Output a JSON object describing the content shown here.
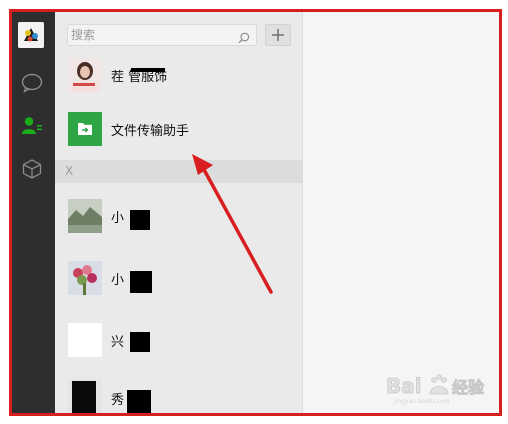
{
  "search": {
    "placeholder": "搜索"
  },
  "contacts": {
    "top_item": {
      "label": "茬 管服饰"
    },
    "file_transfer": {
      "label": "文件传输助手"
    },
    "section_header": "X",
    "items": [
      {
        "label": "小"
      },
      {
        "label": "小"
      },
      {
        "label": "兴"
      },
      {
        "label": "秀"
      }
    ]
  },
  "colors": {
    "annotation_red": "#d81e1e",
    "active_green": "#1aad19",
    "file_transfer_green": "#2ea646"
  },
  "icons": [
    "chat-icon",
    "contacts-icon",
    "favorites-icon",
    "search-icon",
    "plus-icon",
    "file-transfer-icon"
  ],
  "watermark": "Baidu经验"
}
